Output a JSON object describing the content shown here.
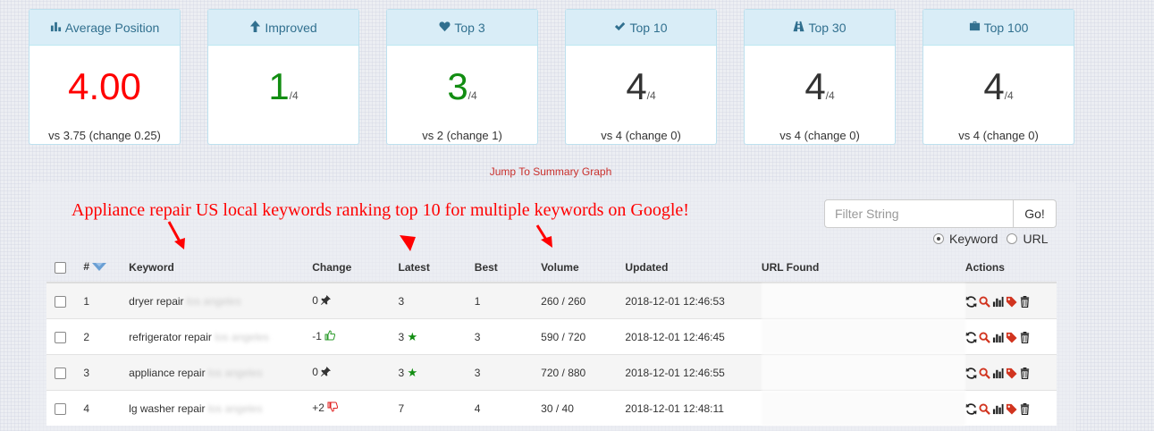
{
  "cards": [
    {
      "label": "Average Position",
      "icon": "bar-chart-icon",
      "value": "4.00",
      "denom": "",
      "compare": "vs 3.75 (change 0.25)"
    },
    {
      "label": "Improved",
      "icon": "arrow-up-icon",
      "value": "1",
      "denom": "/4",
      "compare": ""
    },
    {
      "label": "Top 3",
      "icon": "heart-icon",
      "value": "3",
      "denom": "/4",
      "compare": "vs 2 (change 1)"
    },
    {
      "label": "Top 10",
      "icon": "checkmark-icon",
      "value": "4",
      "denom": "/4",
      "compare": "vs 4 (change 0)"
    },
    {
      "label": "Top 30",
      "icon": "road-icon",
      "value": "4",
      "denom": "/4",
      "compare": "vs 4 (change 0)"
    },
    {
      "label": "Top 100",
      "icon": "briefcase-icon",
      "value": "4",
      "denom": "/4",
      "compare": "vs 4 (change 0)"
    }
  ],
  "jump_link": "Jump To Summary Graph",
  "annotation": "Appliance repair US local keywords ranking top 10 for multiple keywords on Google!",
  "filter": {
    "placeholder": "Filter String",
    "button": "Go!"
  },
  "radios": {
    "keyword": "Keyword",
    "url": "URL",
    "selected": "Keyword"
  },
  "table": {
    "headers": {
      "num": "#",
      "keyword": "Keyword",
      "change": "Change",
      "latest": "Latest",
      "best": "Best",
      "volume": "Volume",
      "updated": "Updated",
      "url": "URL Found",
      "actions": "Actions"
    },
    "rows": [
      {
        "num": "1",
        "keyword": "dryer repair",
        "keyword_blur": "los angeles",
        "change": "0",
        "change_icon": "pin-icon",
        "latest": "3",
        "latest_star": false,
        "best": "1",
        "volume": "260 / 260",
        "updated": "2018-12-01 12:46:53"
      },
      {
        "num": "2",
        "keyword": "refrigerator repair",
        "keyword_blur": "los angeles",
        "change": "-1",
        "change_icon": "thumbs-up-icon",
        "latest": "3",
        "latest_star": true,
        "best": "3",
        "volume": "590 / 720",
        "updated": "2018-12-01 12:46:45"
      },
      {
        "num": "3",
        "keyword": "appliance repair",
        "keyword_blur": "los angeles",
        "change": "0",
        "change_icon": "pin-icon",
        "latest": "3",
        "latest_star": true,
        "best": "3",
        "volume": "720 / 880",
        "updated": "2018-12-01 12:46:55"
      },
      {
        "num": "4",
        "keyword": "lg washer repair",
        "keyword_blur": "los angeles",
        "change": "+2",
        "change_icon": "thumbs-down-icon",
        "latest": "7",
        "latest_star": false,
        "best": "4",
        "volume": "30 / 40",
        "updated": "2018-12-01 12:48:11"
      }
    ]
  },
  "colors": {
    "accent_red": "#ff0000",
    "green": "#128d12",
    "header_bg": "#d9edf7",
    "header_text": "#31708f"
  }
}
